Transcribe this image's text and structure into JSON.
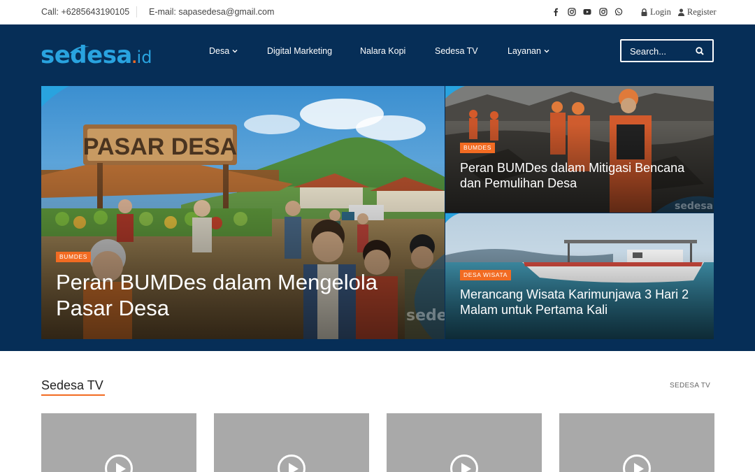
{
  "topbar": {
    "call": "Call: +6285643190105",
    "email": "E-mail: sapasedesa@gmail.com",
    "social_icons": [
      "facebook-icon",
      "instagram-icon",
      "youtube-icon",
      "instagram-icon",
      "whatsapp-icon"
    ],
    "login": "Login",
    "register": "Register"
  },
  "logo": {
    "main": "sedesa",
    "tld": "id"
  },
  "nav": {
    "items": [
      {
        "label": "Desa",
        "dropdown": true
      },
      {
        "label": "Digital Marketing",
        "dropdown": false
      },
      {
        "label": "Nalara Kopi",
        "dropdown": false
      },
      {
        "label": "Sedesa TV",
        "dropdown": false
      },
      {
        "label": "Layanan",
        "dropdown": true
      }
    ]
  },
  "search": {
    "placeholder": "Search..."
  },
  "hero": {
    "main": {
      "badge": "BUMDES",
      "title": "Peran BUMDes dalam Mengelola Pasar Desa",
      "sign": "PASAR DESA",
      "watermark": "sedesa"
    },
    "side": [
      {
        "badge": "BUMDES",
        "title": "Peran BUMDes dalam Mitigasi Bencana dan Pemulihan Desa",
        "watermark": "sedesa"
      },
      {
        "badge": "DESA WISATA",
        "title": "Merancang Wisata Karimunjawa 3 Hari 2 Malam untuk Pertama Kali"
      }
    ]
  },
  "section": {
    "title": "Sedesa TV",
    "link": "SEDESA TV"
  },
  "colors": {
    "navy": "#062e57",
    "accent": "#f26b22",
    "brand": "#29a3df"
  }
}
